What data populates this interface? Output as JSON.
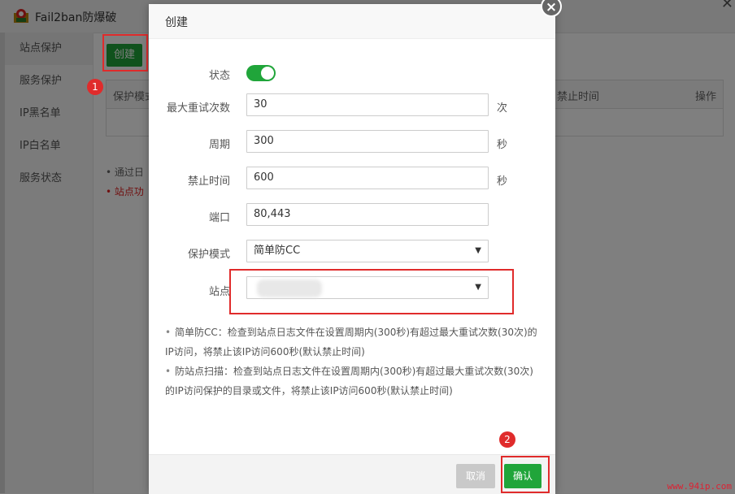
{
  "app": {
    "title": "Fail2ban防爆破",
    "sidebar": [
      "站点保护",
      "服务保护",
      "IP黑名单",
      "IP白名单",
      "服务状态"
    ],
    "create_button": "创建",
    "table_headers": [
      "保护模式",
      "禁止时间",
      "操作"
    ],
    "notes": [
      "通过日",
      "站点功"
    ]
  },
  "modal": {
    "title": "创建",
    "close_icon": "close-icon",
    "fields": {
      "status": {
        "label": "状态",
        "enabled": true
      },
      "max_retry": {
        "label": "最大重试次数",
        "value": "30",
        "unit": "次"
      },
      "period": {
        "label": "周期",
        "value": "300",
        "unit": "秒"
      },
      "ban_time": {
        "label": "禁止时间",
        "value": "600",
        "unit": "秒"
      },
      "port": {
        "label": "端口",
        "value": "80,443"
      },
      "mode": {
        "label": "保护模式",
        "value": "简单防CC"
      },
      "site": {
        "label": "站点",
        "value": ""
      }
    },
    "help": [
      "简单防CC：检查到站点日志文件在设置周期内(300秒)有超过最大重试次数(30次)的IP访问，将禁止该IP访问600秒(默认禁止时间)",
      "防站点扫描：检查到站点日志文件在设置周期内(300秒)有超过最大重试次数(30次)的IP访问保护的目录或文件，将禁止该IP访问600秒(默认禁止时间)"
    ],
    "cancel": "取消",
    "confirm": "确认"
  },
  "annotations": {
    "badge1": "1",
    "badge2": "2",
    "color": "#e02b2b"
  },
  "watermark": "www.94ip.com"
}
